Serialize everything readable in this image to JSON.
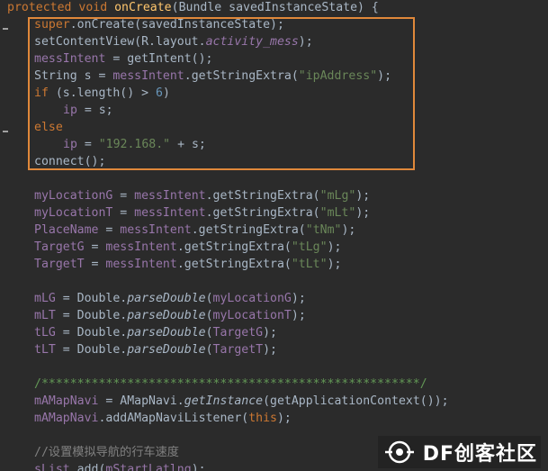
{
  "code": {
    "lines": [
      [
        {
          "t": "protected void ",
          "c": "kw"
        },
        {
          "t": "onCreate",
          "c": "fn"
        },
        {
          "t": "(Bundle savedInstanceState) {",
          "c": "plain"
        }
      ],
      [
        {
          "t": "super",
          "c": "kw"
        },
        {
          "t": ".onCreate(savedInstanceState);",
          "c": "plain"
        }
      ],
      [
        {
          "t": "setContentView(R.layout.",
          "c": "plain"
        },
        {
          "t": "activity_mess",
          "c": "fld ital"
        },
        {
          "t": ");",
          "c": "plain"
        }
      ],
      [
        {
          "t": "messIntent",
          "c": "fld"
        },
        {
          "t": " = getIntent();",
          "c": "plain"
        }
      ],
      [
        {
          "t": "String s = ",
          "c": "plain"
        },
        {
          "t": "messIntent",
          "c": "fld"
        },
        {
          "t": ".getStringExtra(",
          "c": "plain"
        },
        {
          "t": "\"ipAddress\"",
          "c": "str"
        },
        {
          "t": ");",
          "c": "plain"
        }
      ],
      [
        {
          "t": "if ",
          "c": "kw"
        },
        {
          "t": "(s.length() > ",
          "c": "plain"
        },
        {
          "t": "6",
          "c": "num"
        },
        {
          "t": ")",
          "c": "plain"
        }
      ],
      [
        {
          "t": "ip",
          "c": "fld"
        },
        {
          "t": " = s;",
          "c": "plain"
        }
      ],
      [
        {
          "t": "else",
          "c": "kw"
        }
      ],
      [
        {
          "t": "ip",
          "c": "fld"
        },
        {
          "t": " = ",
          "c": "plain"
        },
        {
          "t": "\"192.168.\"",
          "c": "str"
        },
        {
          "t": " + s;",
          "c": "plain"
        }
      ],
      [
        {
          "t": "connect();",
          "c": "plain"
        }
      ],
      [],
      [
        {
          "t": "myLocationG",
          "c": "fld"
        },
        {
          "t": " = ",
          "c": "plain"
        },
        {
          "t": "messIntent",
          "c": "fld"
        },
        {
          "t": ".getStringExtra(",
          "c": "plain"
        },
        {
          "t": "\"mLg\"",
          "c": "str"
        },
        {
          "t": ");",
          "c": "plain"
        }
      ],
      [
        {
          "t": "myLocationT",
          "c": "fld"
        },
        {
          "t": " = ",
          "c": "plain"
        },
        {
          "t": "messIntent",
          "c": "fld"
        },
        {
          "t": ".getStringExtra(",
          "c": "plain"
        },
        {
          "t": "\"mLt\"",
          "c": "str"
        },
        {
          "t": ");",
          "c": "plain"
        }
      ],
      [
        {
          "t": "PlaceName",
          "c": "fld"
        },
        {
          "t": " = ",
          "c": "plain"
        },
        {
          "t": "messIntent",
          "c": "fld"
        },
        {
          "t": ".getStringExtra(",
          "c": "plain"
        },
        {
          "t": "\"tNm\"",
          "c": "str"
        },
        {
          "t": ");",
          "c": "plain"
        }
      ],
      [
        {
          "t": "TargetG",
          "c": "fld"
        },
        {
          "t": " = ",
          "c": "plain"
        },
        {
          "t": "messIntent",
          "c": "fld"
        },
        {
          "t": ".getStringExtra(",
          "c": "plain"
        },
        {
          "t": "\"tLg\"",
          "c": "str"
        },
        {
          "t": ");",
          "c": "plain"
        }
      ],
      [
        {
          "t": "TargetT",
          "c": "fld"
        },
        {
          "t": " = ",
          "c": "plain"
        },
        {
          "t": "messIntent",
          "c": "fld"
        },
        {
          "t": ".getStringExtra(",
          "c": "plain"
        },
        {
          "t": "\"tLt\"",
          "c": "str"
        },
        {
          "t": ");",
          "c": "plain"
        }
      ],
      [],
      [
        {
          "t": "mLG",
          "c": "fld"
        },
        {
          "t": " = Double.",
          "c": "plain"
        },
        {
          "t": "parseDouble",
          "c": "plain ital"
        },
        {
          "t": "(",
          "c": "plain"
        },
        {
          "t": "myLocationG",
          "c": "fld"
        },
        {
          "t": ");",
          "c": "plain"
        }
      ],
      [
        {
          "t": "mLT",
          "c": "fld"
        },
        {
          "t": " = Double.",
          "c": "plain"
        },
        {
          "t": "parseDouble",
          "c": "plain ital"
        },
        {
          "t": "(",
          "c": "plain"
        },
        {
          "t": "myLocationT",
          "c": "fld"
        },
        {
          "t": ");",
          "c": "plain"
        }
      ],
      [
        {
          "t": "tLG",
          "c": "fld"
        },
        {
          "t": " = Double.",
          "c": "plain"
        },
        {
          "t": "parseDouble",
          "c": "plain ital"
        },
        {
          "t": "(",
          "c": "plain"
        },
        {
          "t": "TargetG",
          "c": "fld"
        },
        {
          "t": ");",
          "c": "plain"
        }
      ],
      [
        {
          "t": "tLT",
          "c": "fld"
        },
        {
          "t": " = Double.",
          "c": "plain"
        },
        {
          "t": "parseDouble",
          "c": "plain ital"
        },
        {
          "t": "(",
          "c": "plain"
        },
        {
          "t": "TargetT",
          "c": "fld"
        },
        {
          "t": ");",
          "c": "plain"
        }
      ],
      [],
      [
        {
          "t": "/*****************************************************/",
          "c": "cmtg"
        }
      ],
      [
        {
          "t": "mAMapNavi",
          "c": "fld"
        },
        {
          "t": " = AMapNavi.",
          "c": "plain"
        },
        {
          "t": "getInstance",
          "c": "plain ital"
        },
        {
          "t": "(getApplicationContext());",
          "c": "plain"
        }
      ],
      [
        {
          "t": "mAMapNavi",
          "c": "fld"
        },
        {
          "t": ".addAMapNaviListener(",
          "c": "plain"
        },
        {
          "t": "this",
          "c": "kw"
        },
        {
          "t": ");",
          "c": "plain"
        }
      ],
      [],
      [
        {
          "t": "//设置模拟导航的行车速度",
          "c": "cmt"
        }
      ],
      [
        {
          "t": "sList",
          "c": "fld"
        },
        {
          "t": ".add(",
          "c": "plain"
        },
        {
          "t": "mStartLatlng",
          "c": "fld"
        },
        {
          "t": ");",
          "c": "plain"
        }
      ]
    ]
  },
  "watermark": {
    "text": "DF创客社区",
    "icon": "df-logo-icon",
    "color": "#ffffff"
  },
  "colors": {
    "background": "#2b2b2b",
    "highlight_border": "#e0883a"
  }
}
